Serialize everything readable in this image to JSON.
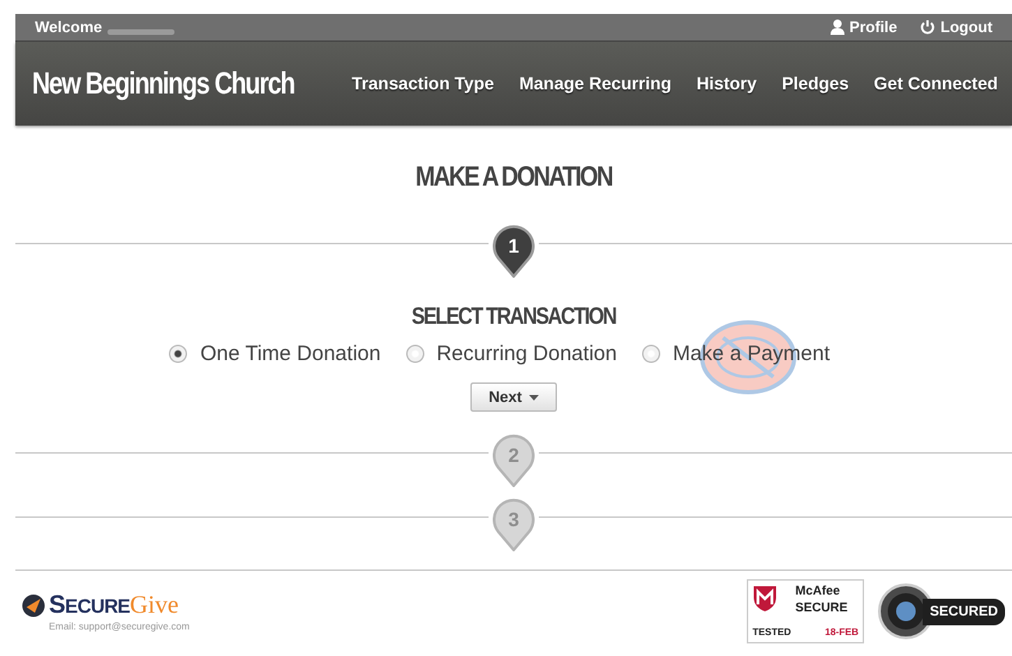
{
  "top_bar": {
    "welcome": "Welcome",
    "links": [
      {
        "label": "Profile"
      },
      {
        "label": "Logout"
      }
    ]
  },
  "nav": {
    "brand": "New Beginnings Church",
    "items": [
      "Transaction Type",
      "Manage Recurring",
      "History",
      "Pledges",
      "Get Connected"
    ]
  },
  "heading": "MAKE A DONATION",
  "steps": [
    {
      "number": "1",
      "active": true,
      "title": "SELECT TRANSACTION",
      "options": [
        {
          "label": "One Time Donation",
          "selected": true
        },
        {
          "label": "Recurring Donation",
          "selected": false
        },
        {
          "label": "Make a Payment",
          "selected": false
        }
      ],
      "button": "Next"
    },
    {
      "number": "2",
      "active": false
    },
    {
      "number": "3",
      "active": false
    }
  ],
  "footer": {
    "brand_first": "SECURE",
    "brand_second": "Give",
    "email": "Email: support@securegive.com",
    "badges": [
      {
        "kind": "mcafee",
        "lines": [
          "McAfee",
          "SECURE",
          "TESTED",
          "18-FEB"
        ]
      },
      {
        "kind": "godaddy",
        "lines": [
          "SECURED"
        ]
      }
    ]
  }
}
